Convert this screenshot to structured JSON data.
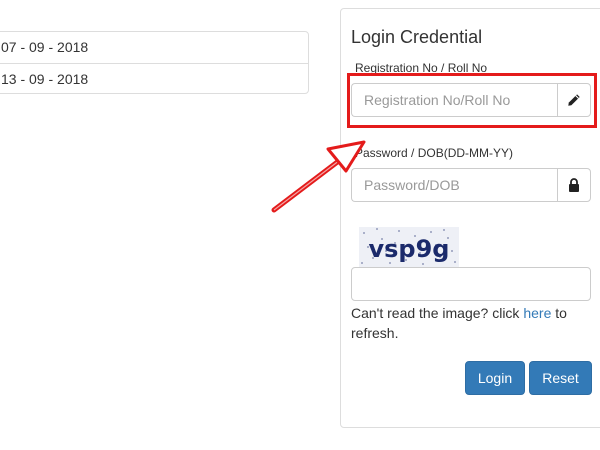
{
  "dates": [
    {
      "text": "07 - 09 - 2018"
    },
    {
      "text": "13 - 09 - 2018"
    }
  ],
  "login": {
    "title": "Login Credential",
    "registration": {
      "label": "Registration No / Roll No",
      "placeholder": "Registration No/Roll No",
      "value": "",
      "addon_icon": "pencil-icon"
    },
    "password": {
      "label": "Password / DOB(DD-MM-YY)",
      "placeholder": "Password/DOB",
      "value": "",
      "addon_icon": "lock-icon"
    },
    "captcha": {
      "image_text": "vsp9g",
      "value": ""
    },
    "refresh": {
      "prefix": "Can't read the image? click ",
      "link": "here",
      "suffix": " to refresh."
    },
    "buttons": {
      "login": "Login",
      "reset": "Reset"
    }
  },
  "annotation": {
    "highlight_color": "#e41b1b",
    "arrow_color": "#e41b1b"
  },
  "colors": {
    "primary": "#337ab7",
    "border": "#dddddd",
    "link": "#337ab7"
  }
}
